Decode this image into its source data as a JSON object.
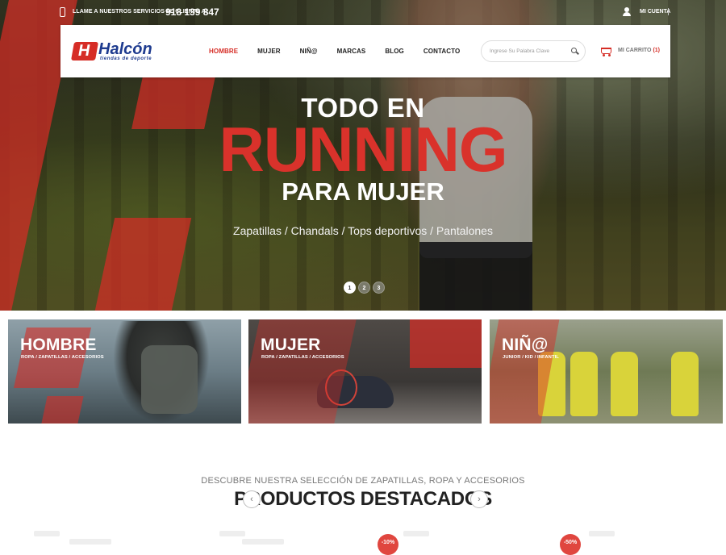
{
  "topbar": {
    "call_text": "LLAME A NUESTROS SERVICIOS AL CLIENTE A:",
    "phone_number": "918 139 847",
    "account_label": "MI CUENTA"
  },
  "header": {
    "logo_mark": "H",
    "logo_word": "Halcón",
    "logo_sub": "tiendas de deporte",
    "nav": [
      {
        "label": "HOMBRE",
        "active": true
      },
      {
        "label": "MUJER",
        "active": false
      },
      {
        "label": "NIÑ@",
        "active": false
      },
      {
        "label": "MARCAS",
        "active": false
      },
      {
        "label": "BLOG",
        "active": false
      },
      {
        "label": "CONTACTO",
        "active": false
      }
    ],
    "search_placeholder": "Ingrese Su Palabra Clave",
    "cart_label": "MI CARRITO",
    "cart_count": "(1)"
  },
  "hero": {
    "line1": "TODO EN",
    "line2": "RUNNING",
    "line3": "PARA MUJER",
    "categories": "Zapatillas / Chandals / Tops deportivos / Pantalones",
    "slides": [
      "1",
      "2",
      "3"
    ],
    "active_slide": 0
  },
  "tiles": [
    {
      "title": "HOMBRE",
      "subtitle": "ROPA / ZAPATILLAS / ACCESORIOS"
    },
    {
      "title": "MUJER",
      "subtitle": "ROPA / ZAPATILLAS / ACCESORIOS"
    },
    {
      "title": "NIÑ@",
      "subtitle": "JUNIOR / KID / INFANTIL"
    }
  ],
  "featured": {
    "subtitle": "DESCUBRE NUESTRA SELECCIÓN DE ZAPATILLAS, ROPA Y ACCESORIOS",
    "title": "PRODUCTOS DESTACADOS",
    "prev_arrow": "‹",
    "next_arrow": "›",
    "badges": [
      "-10%",
      "-50%"
    ]
  },
  "colors": {
    "accent": "#d62d26",
    "brand_blue": "#1e3b8f"
  }
}
